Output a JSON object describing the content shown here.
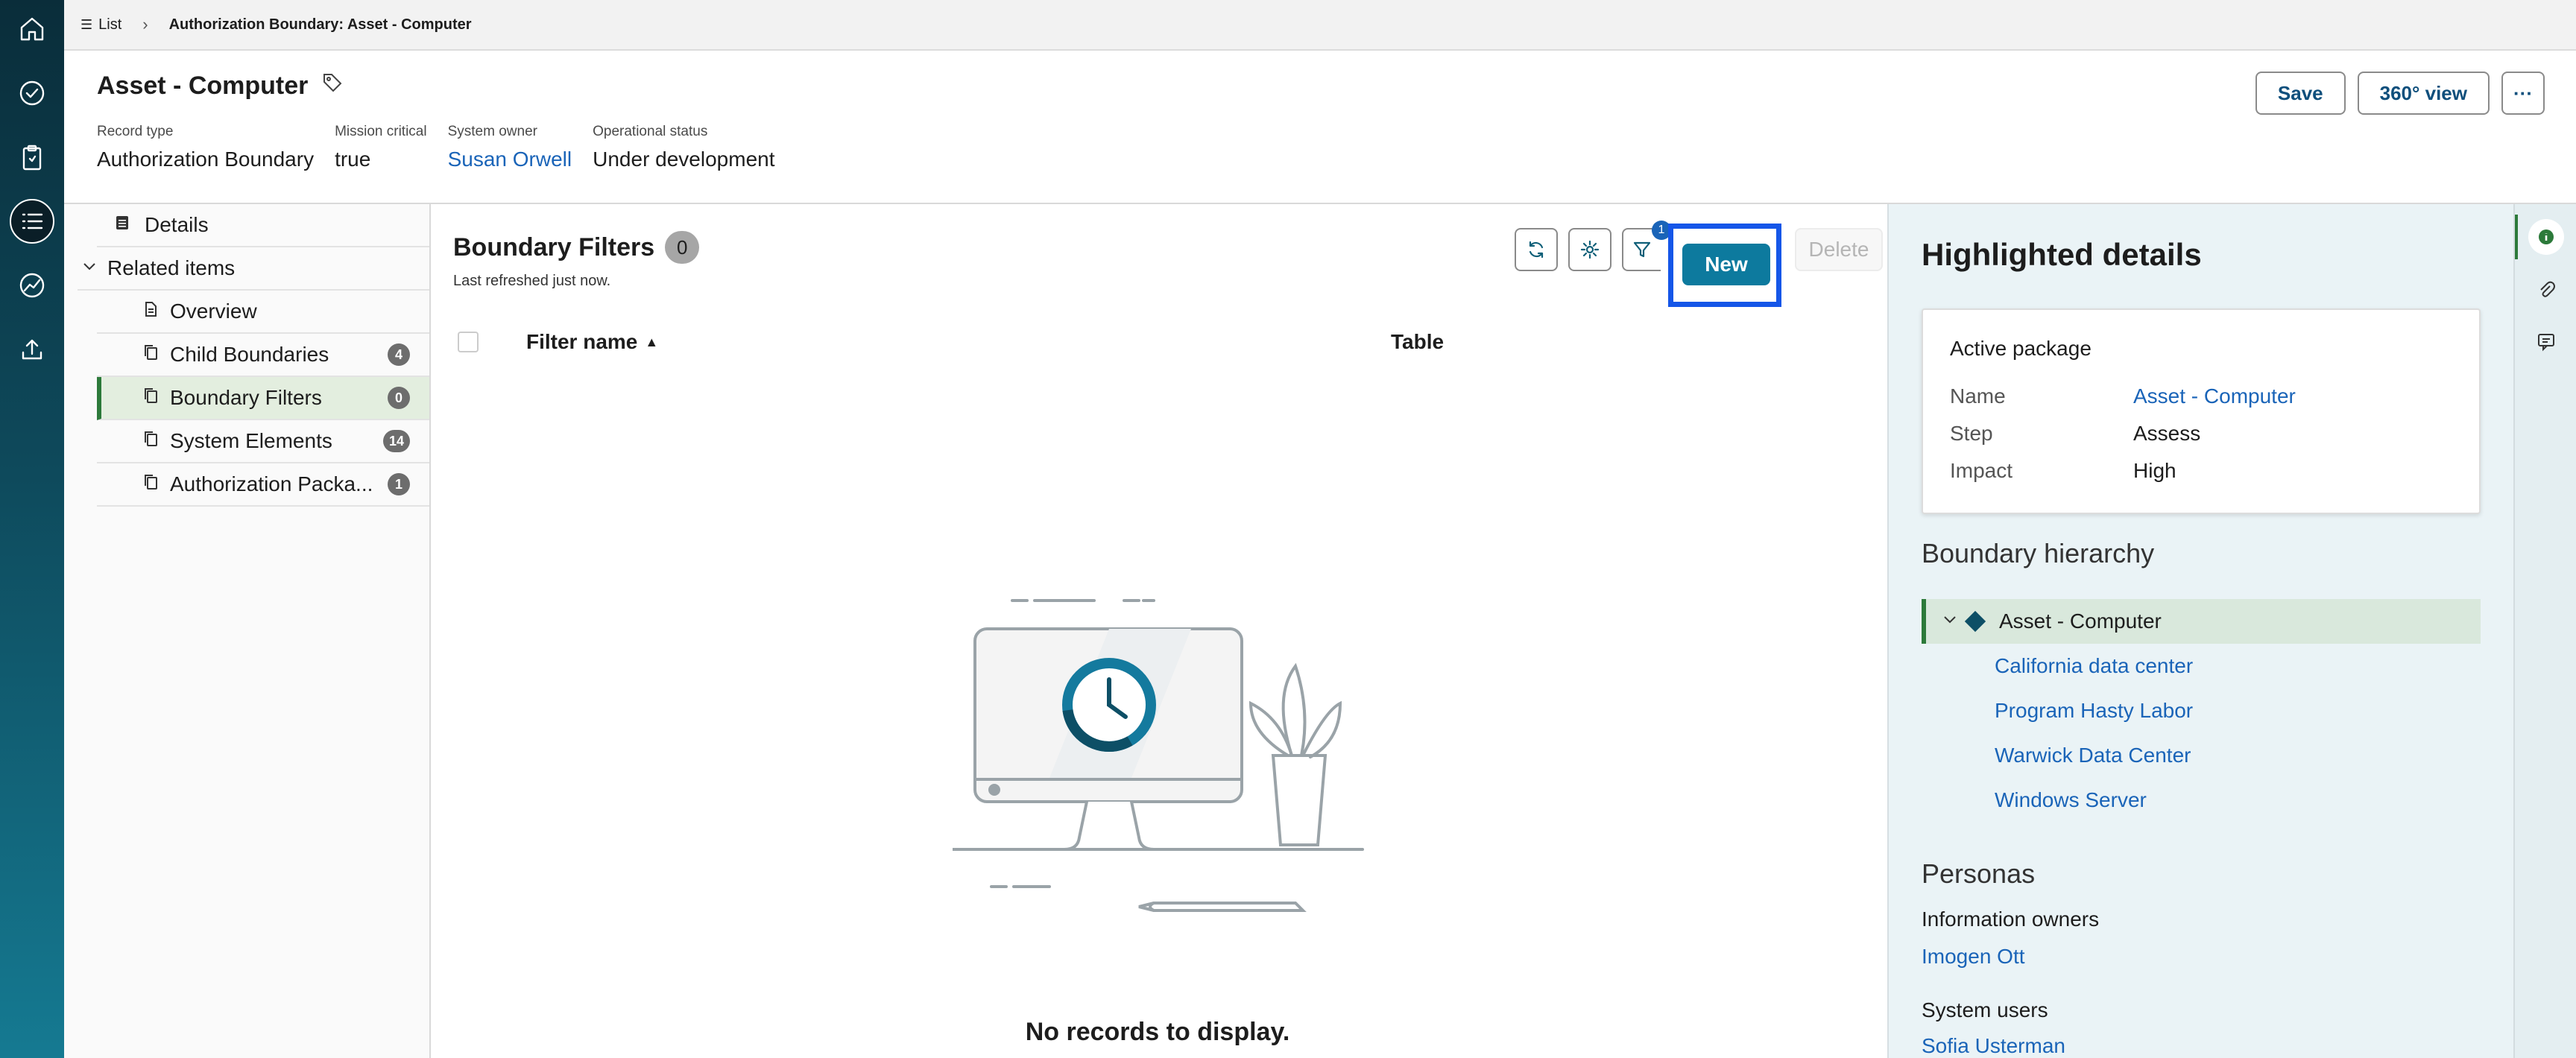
{
  "breadcrumb": {
    "list_label": "List",
    "current": "Authorization Boundary: Asset - Computer"
  },
  "record": {
    "title": "Asset - Computer",
    "fields": [
      {
        "label": "Record type",
        "value": "Authorization Boundary"
      },
      {
        "label": "Mission critical",
        "value": "true"
      },
      {
        "label": "System owner",
        "value": "Susan Orwell"
      },
      {
        "label": "Operational status",
        "value": "Under development"
      }
    ],
    "buttons": {
      "save": "Save",
      "view360": "360° view",
      "more": "···"
    }
  },
  "left_panel": {
    "details": "Details",
    "related": "Related items",
    "items": [
      {
        "label": "Overview",
        "count": ""
      },
      {
        "label": "Child Boundaries",
        "count": "4"
      },
      {
        "label": "Boundary Filters",
        "count": "0"
      },
      {
        "label": "System Elements",
        "count": "14"
      },
      {
        "label": "Authorization Packa...",
        "count": "1"
      }
    ]
  },
  "main": {
    "title": "Boundary Filters",
    "count": "0",
    "refreshed": "Last refreshed just now.",
    "filter_badge": "1",
    "new_label": "New",
    "delete_label": "Delete",
    "columns": [
      "Filter name",
      "Table"
    ],
    "empty_message": "No records to display."
  },
  "right_panel": {
    "title": "Highlighted details",
    "card": {
      "title": "Active package",
      "rows": [
        {
          "key": "Name",
          "value": "Asset - Computer"
        },
        {
          "key": "Step",
          "value": "Assess"
        },
        {
          "key": "Impact",
          "value": "High"
        }
      ]
    },
    "hierarchy_title": "Boundary hierarchy",
    "hierarchy_root": "Asset - Computer",
    "hierarchy_children": [
      "California data center",
      "Program Hasty Labor",
      "Warwick Data Center",
      "Windows Server"
    ],
    "personas_title": "Personas",
    "info_owners_label": "Information owners",
    "info_owner": "Imogen Ott",
    "system_users_label": "System users",
    "system_user": "Sofia Usterman"
  },
  "colors": {
    "accent": "#0d7a9e",
    "highlight_border": "#1556e8",
    "link": "#1a64b8",
    "selected_bar": "#2c7a3a"
  }
}
